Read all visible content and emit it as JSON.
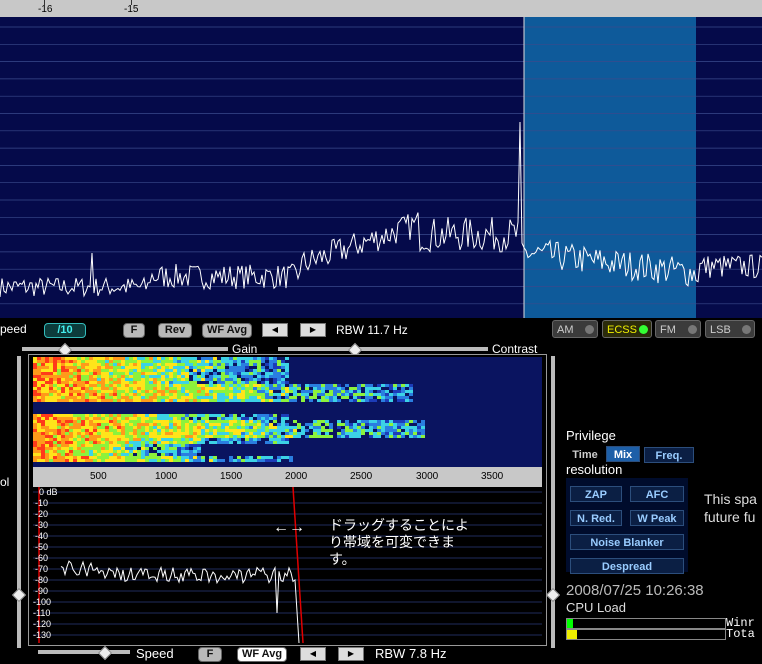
{
  "top_ticks": [
    "-16",
    "-15"
  ],
  "top_controls": {
    "speed_label": "peed",
    "speed_value": "/10",
    "f_label": "F",
    "rev_label": "Rev",
    "wf_avg_label": "WF Avg",
    "rbw_label": "RBW  11.7 Hz"
  },
  "modes": [
    {
      "label": "AM",
      "active": false
    },
    {
      "label": "ECSS",
      "active": true
    },
    {
      "label": "FM",
      "active": false
    },
    {
      "label": "LSB",
      "active": false
    }
  ],
  "gain_label": "Gain",
  "contrast_label": "Contrast",
  "waterfall_x_ticks": [
    "500",
    "1000",
    "1500",
    "2000",
    "2500",
    "3000",
    "3500"
  ],
  "spectrum_y_ticks": [
    "0 dB",
    "-10",
    "-20",
    "-30",
    "-40",
    "-50",
    "-60",
    "-70",
    "-80",
    "-90",
    "-100",
    "-110",
    "-120",
    "-130"
  ],
  "annotation": {
    "arrow": "←→",
    "line1": "ドラッグすることによ",
    "line2": "り帯域を可変できま",
    "line3": "す。"
  },
  "left_label": "ol",
  "bottom_controls": {
    "speed_label": "Speed",
    "f_label": "F",
    "wf_avg_label": "WF Avg",
    "rbw_label": "RBW  7.8 Hz"
  },
  "privilege": {
    "title": "Privilege",
    "options": [
      "Time",
      "Mix",
      "Freq."
    ],
    "selected": "Mix"
  },
  "resolution_label": "resolution",
  "dsp_buttons": {
    "zap": "ZAP",
    "afc": "AFC",
    "nred": "N. Red.",
    "wpeak": "W Peak",
    "noise_blanker": "Noise Blanker",
    "despread": "Despread"
  },
  "info_text": {
    "line1": "This spa",
    "line2": "future fu"
  },
  "timestamp": "2008/07/25 10:26:38",
  "cpu_load_label": "CPU Load",
  "cpu_rows": [
    {
      "label": "Winr",
      "level": 0.02
    },
    {
      "label": "Tota",
      "level": 0.05
    }
  ],
  "colors": {
    "panel_bg": "#050a4a",
    "passband": "#0e5a9a",
    "trace": "#ffffff",
    "marker": "#e00000"
  }
}
